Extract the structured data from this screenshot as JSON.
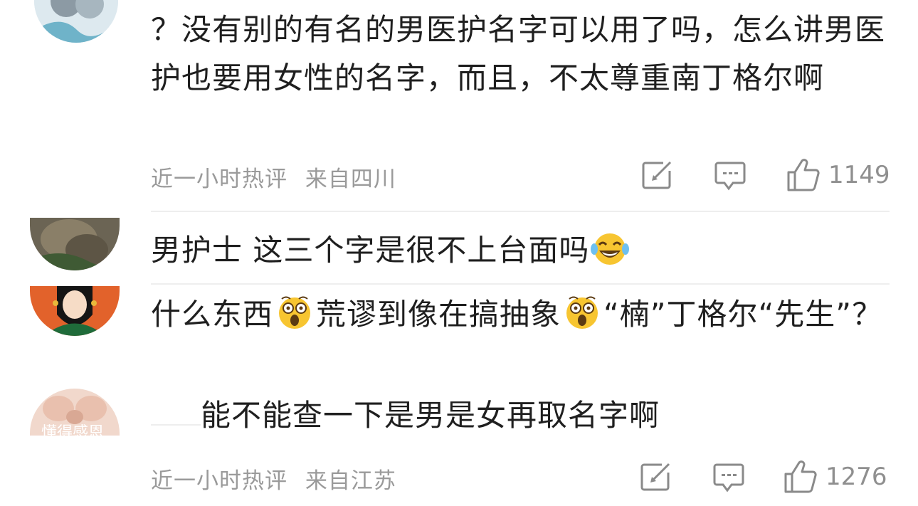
{
  "comment1": {
    "text": "？没有别的有名的男医护名字可以用了吗，怎么讲男医护也要用女性的名字，而且，不太尊重南丁格尔啊",
    "time": "近一小时热评",
    "location": "来自四川",
    "likes": "1149"
  },
  "reply1": {
    "text_before_emoji": "男护士 这三个字是很不上台面吗",
    "emoji": "laughing-tears"
  },
  "reply2": {
    "part1": "什么东西",
    "part2": "荒谬到像在搞抽象",
    "part3": "“楠”丁格尔“先生”？",
    "emoji": "astonished"
  },
  "reply3": {
    "text": "能不能查一下是男是女再取名字啊",
    "avatar_text": "懂得感恩"
  },
  "footer": {
    "time": "近一小时热评",
    "location": "来自江苏",
    "likes": "1276"
  },
  "colors": {
    "meta": "#9a9a9a",
    "divider": "#eeeeee",
    "emoji_yellow": "#f7c531"
  }
}
